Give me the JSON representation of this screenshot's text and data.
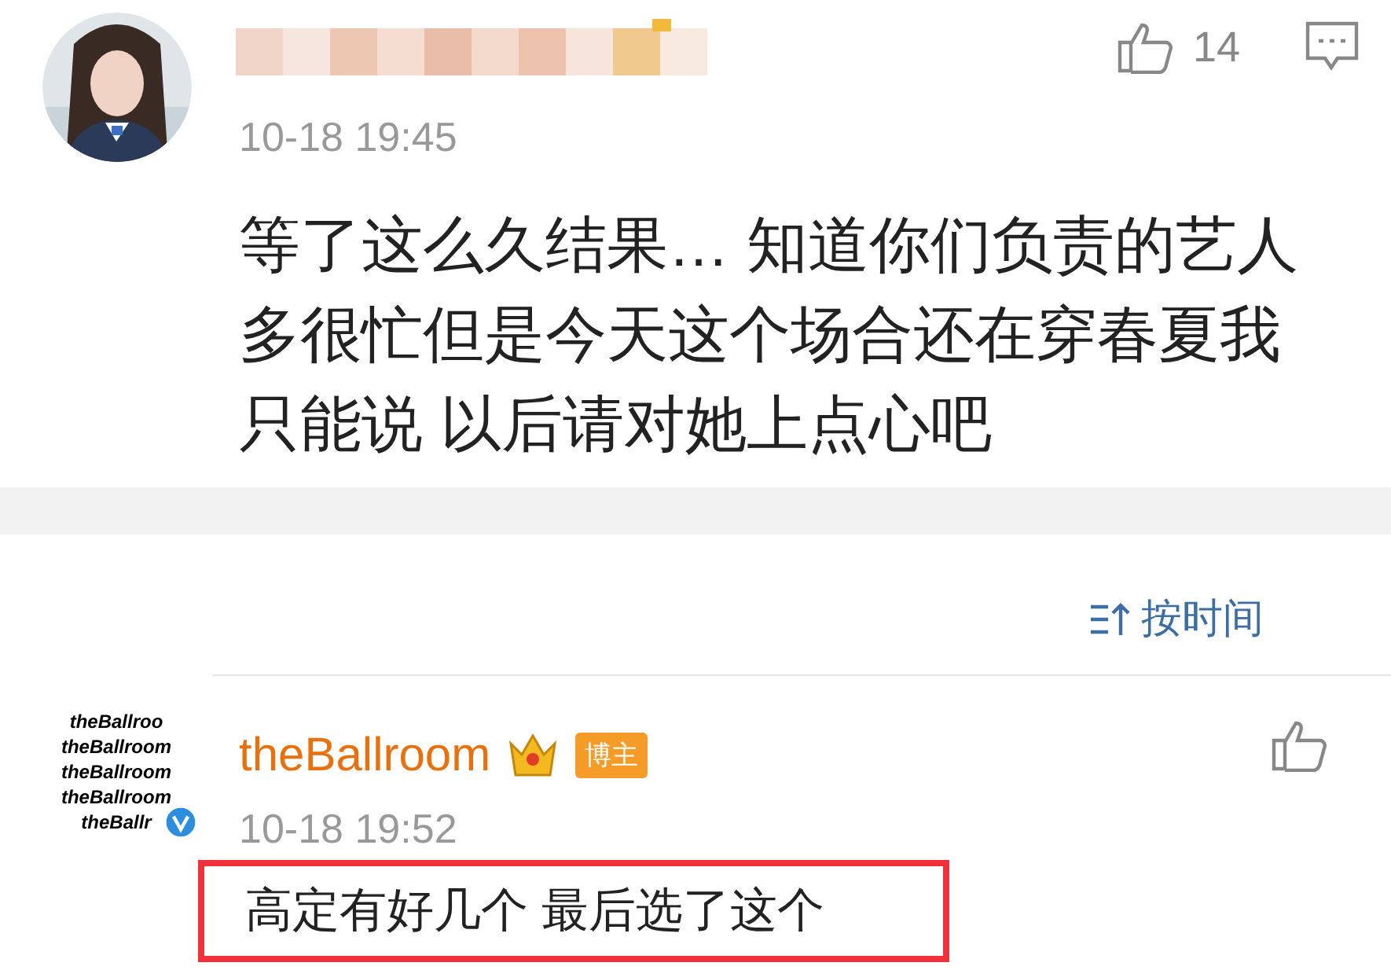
{
  "top_comment": {
    "date": "10-18 19:45",
    "likes": "14",
    "text": "等了这么久结果… 知道你们负责的艺人多很忙但是今天这个场合还在穿春夏我只能说 以后请对她上点心吧"
  },
  "sort": {
    "label": "按时间"
  },
  "reply": {
    "avatar_lines": [
      "theBallroo",
      "theBallroom",
      "theBallroom",
      "theBallroom",
      "theBallr"
    ],
    "name": "theBallroom",
    "badge": "博主",
    "date": "10-18 19:52",
    "text": "高定有好几个 最后选了这个",
    "highlighted": true
  }
}
